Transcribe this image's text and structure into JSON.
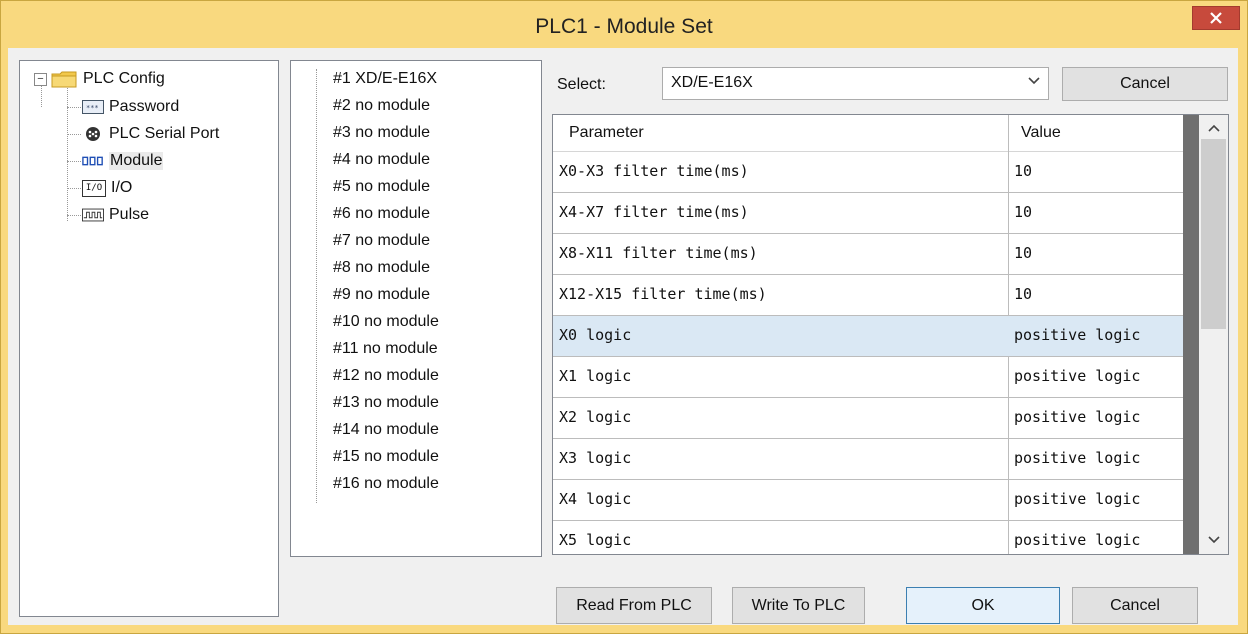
{
  "window": {
    "title": "PLC1 - Module  Set",
    "close_glyph": "✕"
  },
  "config_tree": {
    "root_label": "PLC Config",
    "expander": "−",
    "items": [
      {
        "label": "Password",
        "icon": "password-icon"
      },
      {
        "label": "PLC Serial Port",
        "icon": "serial-port-icon"
      },
      {
        "label": "Module",
        "icon": "module-icon",
        "selected": true
      },
      {
        "label": "I/O",
        "icon": "io-icon",
        "icon_text": "I/O"
      },
      {
        "label": "Pulse",
        "icon": "pulse-icon"
      }
    ]
  },
  "modules": [
    "#1 XD/E-E16X",
    "#2 no module",
    "#3 no module",
    "#4 no module",
    "#5 no module",
    "#6 no module",
    "#7 no module",
    "#8 no module",
    "#9 no module",
    "#10 no module",
    "#11 no module",
    "#12 no module",
    "#13 no module",
    "#14 no module",
    "#15 no module",
    "#16 no module"
  ],
  "select": {
    "label": "Select:",
    "value": "XD/E-E16X",
    "top_cancel_label": "Cancel"
  },
  "grid": {
    "col_param": "Parameter",
    "col_value": "Value",
    "rows": [
      {
        "param": "X0-X3 filter time(ms)",
        "value": "10"
      },
      {
        "param": "X4-X7 filter time(ms)",
        "value": "10"
      },
      {
        "param": "X8-X11 filter time(ms)",
        "value": "10"
      },
      {
        "param": "X12-X15 filter time(ms)",
        "value": "10"
      },
      {
        "param": "X0 logic",
        "value": "positive logic",
        "selected": true
      },
      {
        "param": "X1 logic",
        "value": "positive logic"
      },
      {
        "param": "X2 logic",
        "value": "positive logic"
      },
      {
        "param": "X3 logic",
        "value": "positive logic"
      },
      {
        "param": "X4 logic",
        "value": "positive logic"
      },
      {
        "param": "X5 logic",
        "value": "positive logic"
      }
    ]
  },
  "buttons": {
    "read": "Read From PLC",
    "write": "Write To PLC",
    "ok": "OK",
    "cancel": "Cancel"
  }
}
